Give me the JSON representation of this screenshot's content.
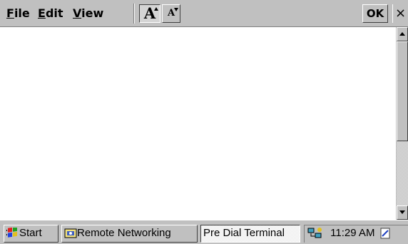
{
  "menu": {
    "file": {
      "pre": "",
      "ul": "F",
      "post": "ile"
    },
    "edit": {
      "pre": "",
      "ul": "E",
      "post": "dit"
    },
    "view": {
      "pre": "",
      "ul": "V",
      "post": "iew"
    }
  },
  "toolbar": {
    "font_larger_glyph": "A",
    "font_smaller_glyph": "A",
    "ok_label": "OK",
    "close_glyph": "×"
  },
  "document": {
    "text": ""
  },
  "taskbar": {
    "start_label": "Start",
    "tasks": [
      {
        "label": "Remote Networking"
      },
      {
        "label": "Pre Dial Terminal"
      }
    ],
    "clock": "11:29 AM"
  },
  "icons": {
    "start": "windows-flag-icon",
    "remote_networking": "remote-networking-icon",
    "tray_network": "network-connection-icon",
    "tray_last": "desktop-icon"
  }
}
